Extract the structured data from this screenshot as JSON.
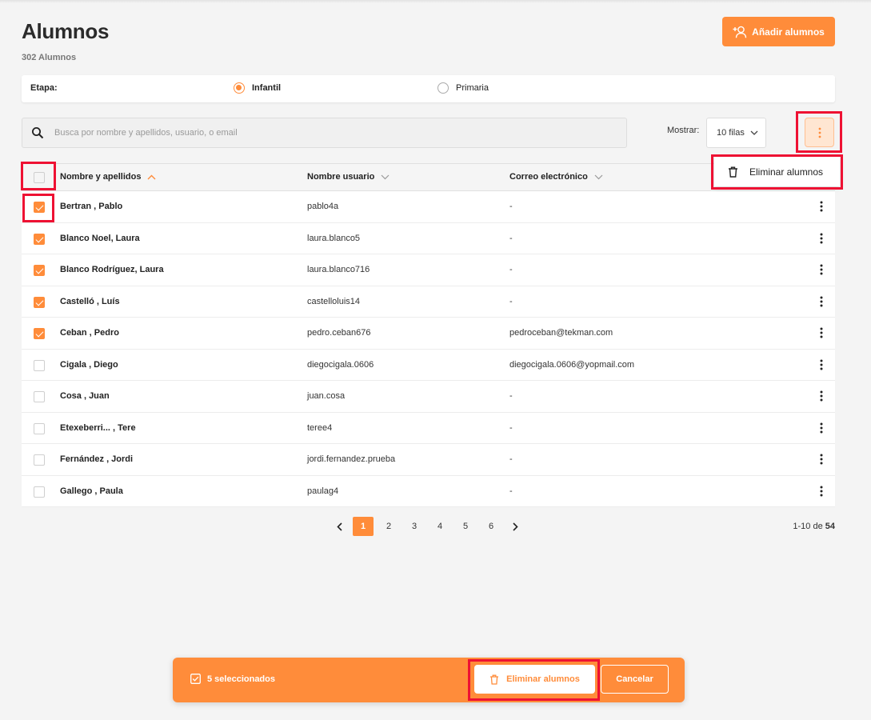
{
  "header": {
    "title": "Alumnos",
    "count": "302 Alumnos",
    "add_button_label": "Añadir alumnos"
  },
  "stage": {
    "label": "Etapa:",
    "options": [
      {
        "label": "Infantil",
        "selected": true
      },
      {
        "label": "Primaria",
        "selected": false
      }
    ]
  },
  "search": {
    "placeholder": "Busca por nombre y apellidos, usuario, o email",
    "value": ""
  },
  "rows_select": {
    "label": "Mostrar:",
    "value": "10 filas"
  },
  "menu": {
    "delete_label": "Eliminar alumnos"
  },
  "table": {
    "columns": [
      "Nombre y apellidos",
      "Nombre usuario",
      "Correo electrónico"
    ],
    "sort": {
      "column": "Nombre y apellidos",
      "direction": "asc"
    },
    "rows": [
      {
        "name": "Bertran , Pablo",
        "username": "pablo4a",
        "email": "-",
        "checked": true
      },
      {
        "name": "Blanco Noel, Laura",
        "username": "laura.blanco5",
        "email": "-",
        "checked": true
      },
      {
        "name": "Blanco Rodríguez, Laura",
        "username": "laura.blanco716",
        "email": "-",
        "checked": true
      },
      {
        "name": "Castelló , Luís",
        "username": "castelloluis14",
        "email": "-",
        "checked": true
      },
      {
        "name": "Ceban , Pedro",
        "username": "pedro.ceban676",
        "email": "pedroceban@tekman.com",
        "checked": true
      },
      {
        "name": "Cigala , Diego",
        "username": "diegocigala.0606",
        "email": "diegocigala.0606@yopmail.com",
        "checked": false
      },
      {
        "name": "Cosa , Juan",
        "username": "juan.cosa",
        "email": "-",
        "checked": false
      },
      {
        "name": "Etexeberri... , Tere",
        "username": "teree4",
        "email": "-",
        "checked": false
      },
      {
        "name": "Fernández , Jordi",
        "username": "jordi.fernandez.prueba",
        "email": "-",
        "checked": false
      },
      {
        "name": "Gallego , Paula",
        "username": "paulag4",
        "email": "-",
        "checked": false
      }
    ]
  },
  "pagination": {
    "pages": [
      "1",
      "2",
      "3",
      "4",
      "5",
      "6"
    ],
    "current": "1",
    "range": "1-10 de",
    "total": "54"
  },
  "action_bar": {
    "selected_label": "5 seleccionados",
    "delete_label": "Eliminar alumnos",
    "cancel_label": "Cancelar"
  },
  "colors": {
    "accent": "#ff8c3a",
    "highlight": "#ee1133",
    "background": "#f4f4f4"
  }
}
